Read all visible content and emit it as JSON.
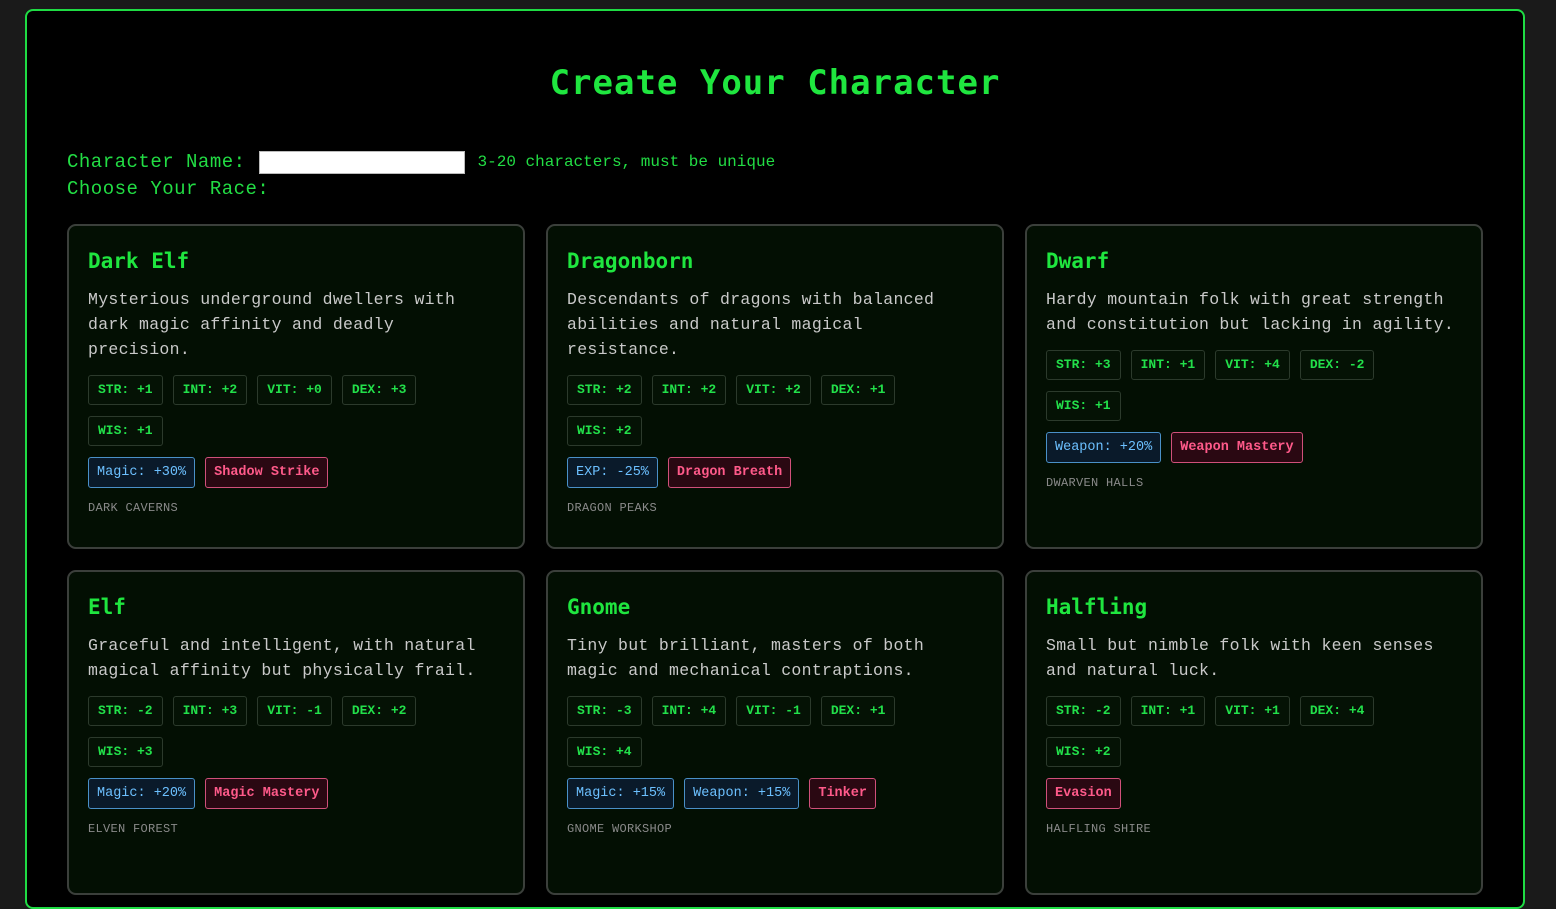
{
  "title": "Create Your Character",
  "name_field": {
    "label": "Character Name:",
    "value": "",
    "placeholder": "",
    "hint": "3-20 characters, must be unique"
  },
  "race_label": "Choose Your Race:",
  "races": [
    {
      "name": "Dark Elf",
      "description": "Mysterious underground dwellers with dark magic affinity and deadly precision.",
      "stats": [
        "STR: +1",
        "INT: +2",
        "VIT: +0",
        "DEX: +3",
        "WIS: +1"
      ],
      "bonuses": [
        "Magic: +30%"
      ],
      "ability": "Shadow Strike",
      "origin": "DARK CAVERNS"
    },
    {
      "name": "Dragonborn",
      "description": "Descendants of dragons with balanced abilities and natural magical resistance.",
      "stats": [
        "STR: +2",
        "INT: +2",
        "VIT: +2",
        "DEX: +1",
        "WIS: +2"
      ],
      "bonuses": [
        "EXP: -25%"
      ],
      "ability": "Dragon Breath",
      "origin": "DRAGON PEAKS"
    },
    {
      "name": "Dwarf",
      "description": "Hardy mountain folk with great strength and constitution but lacking in agility.",
      "stats": [
        "STR: +3",
        "INT: +1",
        "VIT: +4",
        "DEX: -2",
        "WIS: +1"
      ],
      "bonuses": [
        "Weapon: +20%"
      ],
      "ability": "Weapon Mastery",
      "origin": "DWARVEN HALLS"
    },
    {
      "name": "Elf",
      "description": "Graceful and intelligent, with natural magical affinity but physically frail.",
      "stats": [
        "STR: -2",
        "INT: +3",
        "VIT: -1",
        "DEX: +2",
        "WIS: +3"
      ],
      "bonuses": [
        "Magic: +20%"
      ],
      "ability": "Magic Mastery",
      "origin": "ELVEN FOREST"
    },
    {
      "name": "Gnome",
      "description": "Tiny but brilliant, masters of both magic and mechanical contraptions.",
      "stats": [
        "STR: -3",
        "INT: +4",
        "VIT: -1",
        "DEX: +1",
        "WIS: +4"
      ],
      "bonuses": [
        "Magic: +15%",
        "Weapon: +15%"
      ],
      "ability": "Tinker",
      "origin": "GNOME WORKSHOP"
    },
    {
      "name": "Halfling",
      "description": "Small but nimble folk with keen senses and natural luck.",
      "stats": [
        "STR: -2",
        "INT: +1",
        "VIT: +1",
        "DEX: +4",
        "WIS: +2"
      ],
      "bonuses": [],
      "ability": "Evasion",
      "origin": "HALFLING SHIRE"
    }
  ],
  "colors": {
    "accent": "#1fe63f",
    "background": "#000000",
    "card_background": "#030f03",
    "bonus": "#6cc0ff",
    "ability": "#ff5a8a"
  }
}
